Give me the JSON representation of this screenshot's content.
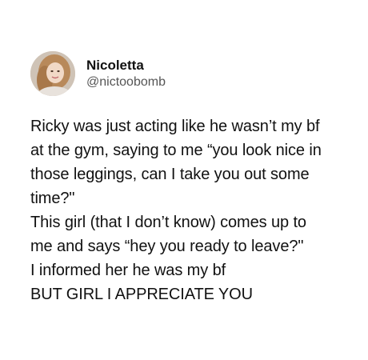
{
  "tweet": {
    "author": {
      "name": "Nicoletta",
      "handle": "@nictoobomb",
      "avatar_icon": "profile-photo-avatar"
    },
    "lines": [
      "Ricky was just acting like he wasn’t my bf",
      "at the gym, saying to me “you look nice in",
      "those leggings, can I take you out some",
      "time?\"",
      "This girl (that I don’t know) comes up to",
      "me and says “hey you ready to leave?\"",
      "I informed her he was my bf",
      "BUT GIRL I APPRECIATE YOU"
    ]
  }
}
